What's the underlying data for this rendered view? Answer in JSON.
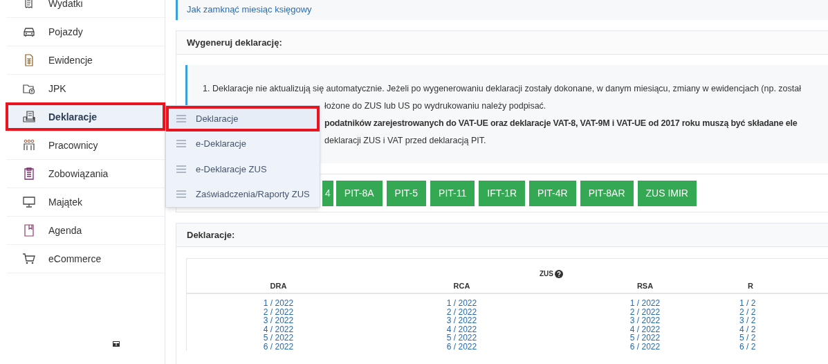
{
  "sidebar": {
    "items": [
      {
        "label": "Wydatki",
        "selected": false
      },
      {
        "label": "Pojazdy",
        "selected": false
      },
      {
        "label": "Ewidencje",
        "selected": false
      },
      {
        "label": "JPK",
        "selected": false
      },
      {
        "label": "Deklaracje",
        "selected": true
      },
      {
        "label": "Pracownicy",
        "selected": false
      },
      {
        "label": "Zobowiązania",
        "selected": false
      },
      {
        "label": "Majątek",
        "selected": false
      },
      {
        "label": "Agenda",
        "selected": false
      },
      {
        "label": "eCommerce",
        "selected": false
      }
    ]
  },
  "submenu": {
    "items": [
      {
        "label": "Deklaracje",
        "highlighted": true
      },
      {
        "label": "e-Deklaracje",
        "highlighted": false
      },
      {
        "label": "e-Deklaracje ZUS",
        "highlighted": false
      },
      {
        "label": "Zaświadczenia/Raporty ZUS",
        "highlighted": false
      }
    ]
  },
  "help_link": "Jak zamknąć miesiąc księgowy",
  "generate_card": {
    "title": "Wygeneruj deklarację:",
    "notes": [
      {
        "text": "1. Deklaracje nie aktualizują się automatycznie. Jeżeli po wygenerowaniu deklaracji zostały dokonane, w danym miesiącu, zmiany w ewidencjach (np. został",
        "bold": false
      },
      {
        "text": "łożone do ZUS lub US po wydrukowaniu należy podpisać.",
        "bold": false
      },
      {
        "text": "podatników zarejestrowanych do VAT-UE oraz deklaracje VAT-8, VAT-9M i VAT-UE od 2017 roku muszą być składane ele",
        "bold": true
      },
      {
        "text": "deklaracji ZUS i VAT przed deklaracją PIT.",
        "bold": false
      }
    ],
    "buttons": [
      "4",
      "PIT-8A",
      "PIT-5",
      "PIT-11",
      "IFT-1R",
      "PIT-4R",
      "PIT-8AR",
      "ZUS IMIR"
    ]
  },
  "declarations_card": {
    "title": "Deklaracje:",
    "group_label": "ZUS",
    "columns": [
      "DRA",
      "RCA",
      "RSA",
      "R"
    ],
    "rows": [
      [
        "1 / 2022",
        "1 / 2022",
        "1 / 2022",
        "1 / 2"
      ],
      [
        "2 / 2022",
        "2 / 2022",
        "2 / 2022",
        "2 / 2"
      ],
      [
        "3 / 2022",
        "3 / 2022",
        "3 / 2022",
        "3 / 2"
      ],
      [
        "4 / 2022",
        "4 / 2022",
        "4 / 2022",
        "4 / 2"
      ],
      [
        "5 / 2022",
        "5 / 2022",
        "5 / 2022",
        "5 / 2"
      ],
      [
        "6 / 2022",
        "6 / 2022",
        "6 / 2022",
        "6 / 2"
      ]
    ]
  }
}
